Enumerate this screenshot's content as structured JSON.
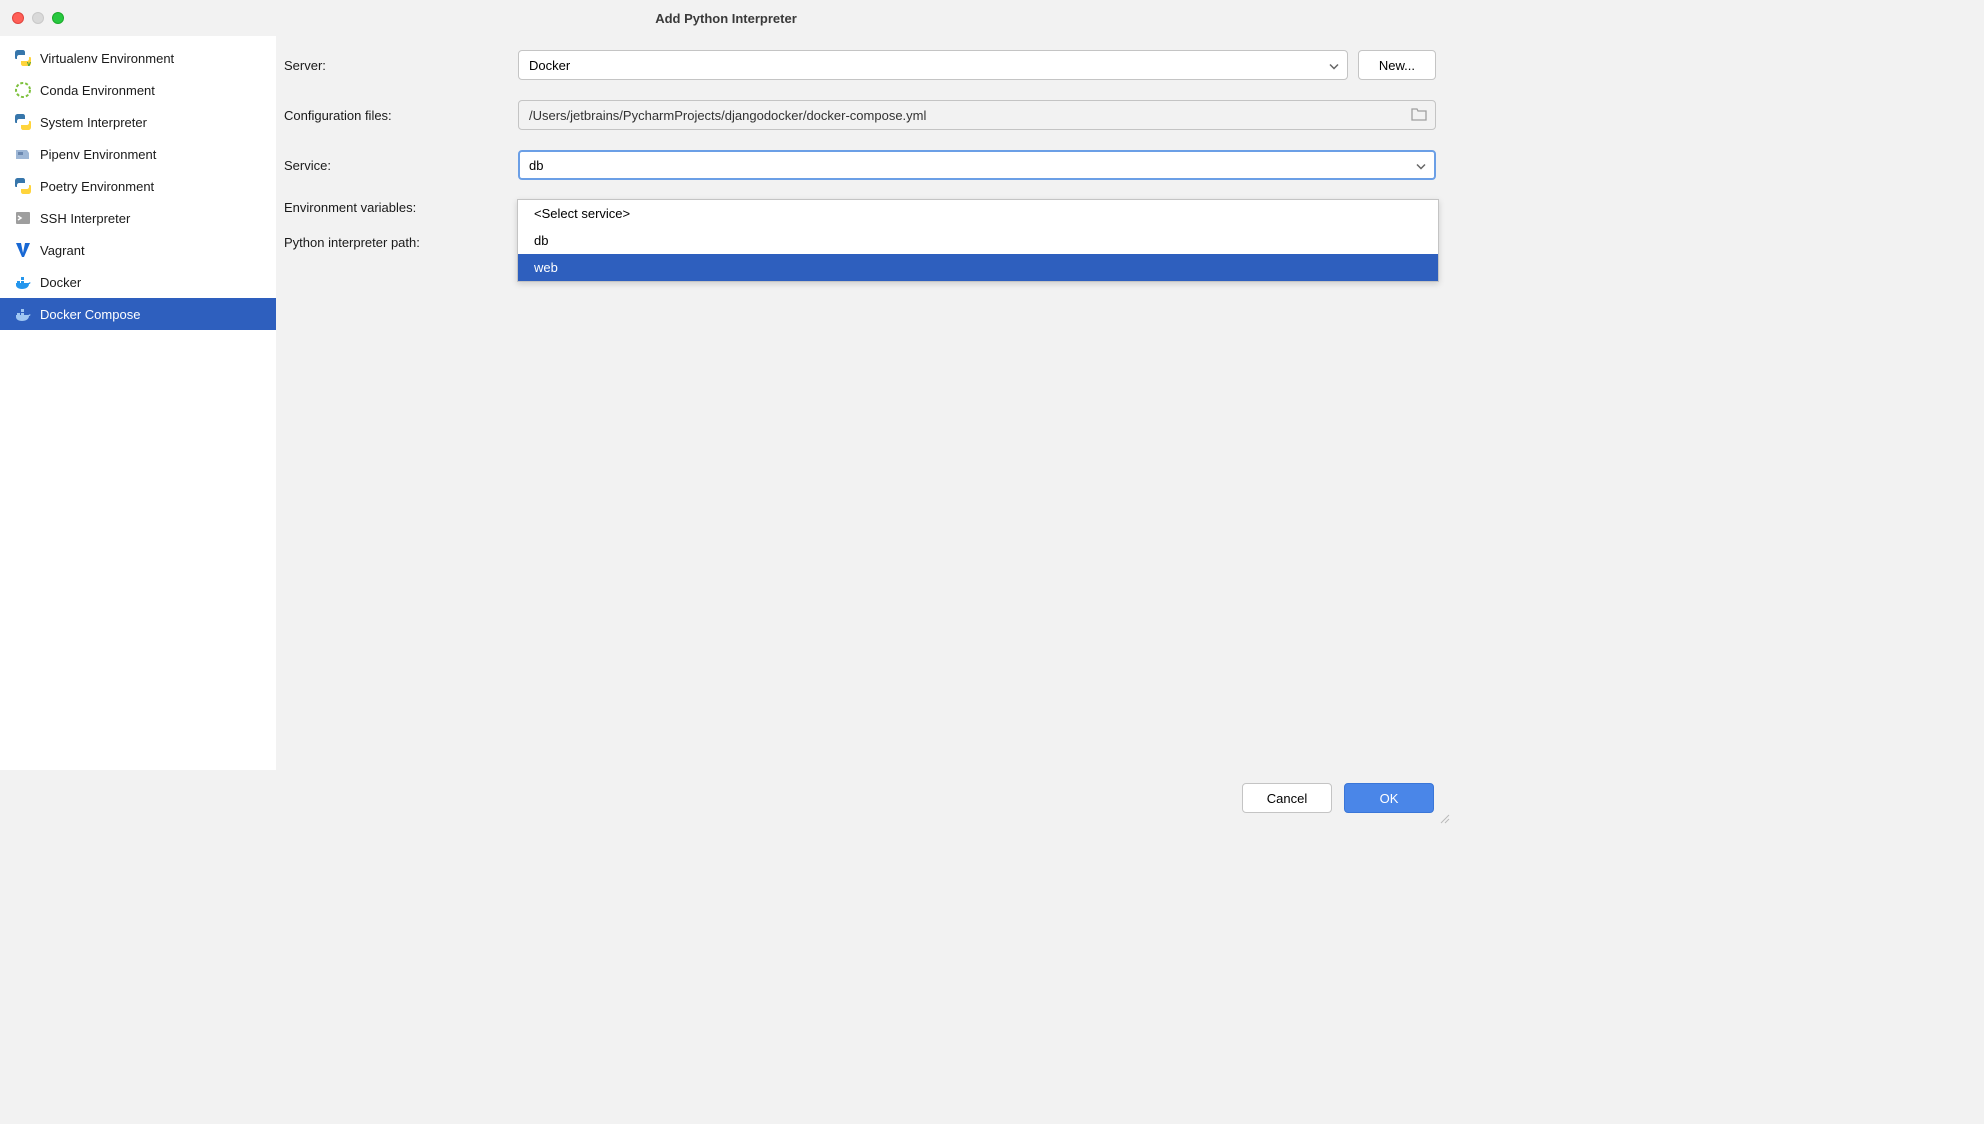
{
  "window": {
    "title": "Add Python Interpreter"
  },
  "sidebar": {
    "items": [
      {
        "label": "Virtualenv Environment",
        "icon": "python-venv-icon"
      },
      {
        "label": "Conda Environment",
        "icon": "conda-icon"
      },
      {
        "label": "System Interpreter",
        "icon": "python-icon"
      },
      {
        "label": "Pipenv Environment",
        "icon": "pipenv-icon"
      },
      {
        "label": "Poetry Environment",
        "icon": "poetry-icon"
      },
      {
        "label": "SSH Interpreter",
        "icon": "ssh-icon"
      },
      {
        "label": "Vagrant",
        "icon": "vagrant-icon"
      },
      {
        "label": "Docker",
        "icon": "docker-icon"
      },
      {
        "label": "Docker Compose",
        "icon": "docker-compose-icon",
        "selected": true
      }
    ]
  },
  "form": {
    "server_label": "Server:",
    "server_value": "Docker",
    "new_button": "New...",
    "config_files_label": "Configuration files:",
    "config_files_value": "/Users/jetbrains/PycharmProjects/djangodocker/docker-compose.yml",
    "service_label": "Service:",
    "service_value": "db",
    "env_vars_label": "Environment variables:",
    "interpreter_path_label": "Python interpreter path:"
  },
  "service_dropdown": {
    "options": [
      {
        "label": "<Select service>"
      },
      {
        "label": "db"
      },
      {
        "label": "web",
        "highlighted": true
      }
    ]
  },
  "footer": {
    "cancel": "Cancel",
    "ok": "OK"
  }
}
